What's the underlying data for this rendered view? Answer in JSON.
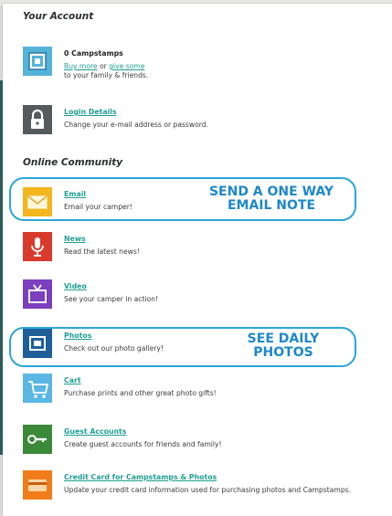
{
  "your_account": {
    "heading": "Your Account",
    "campstamps": {
      "title": "0 Campstamps",
      "link_buy": "Buy more",
      "or": "or",
      "link_give": "give some",
      "rest": "to your family & friends."
    },
    "login": {
      "title": "Login Details",
      "desc": "Change your e-mail address or password."
    }
  },
  "online_community": {
    "heading": "Online Community",
    "items": [
      {
        "title": "Email",
        "desc": "Email your camper!"
      },
      {
        "title": "News",
        "desc": "Read the latest news!"
      },
      {
        "title": "Video",
        "desc": "See your camper in action!"
      },
      {
        "title": "Photos",
        "desc": "Check out our photo gallery!"
      },
      {
        "title": "Cart",
        "desc": "Purchase prints and other great photo gifts!"
      },
      {
        "title": "Guest Accounts",
        "desc": "Create guest accounts for friends and family!"
      },
      {
        "title": "Credit Card for Campstamps & Photos",
        "desc": "Update your credit card information used for purchasing photos and Campstamps."
      }
    ]
  },
  "callouts": {
    "email_line1": "SEND A ONE WAY",
    "email_line2": "EMAIL NOTE",
    "photos_line1": "SEE DAILY",
    "photos_line2": "PHOTOS"
  },
  "colors": {
    "link": "#1f9e93",
    "callout": "#29a6d8",
    "callout_text": "#1e88c8"
  },
  "icons": {
    "campstamps": "stamp-icon",
    "login": "lock-icon",
    "email": "envelope-icon",
    "news": "microphone-icon",
    "video": "tv-icon",
    "photos": "photo-icon",
    "cart": "cart-icon",
    "guest": "key-icon",
    "credit": "credit-card-icon"
  }
}
